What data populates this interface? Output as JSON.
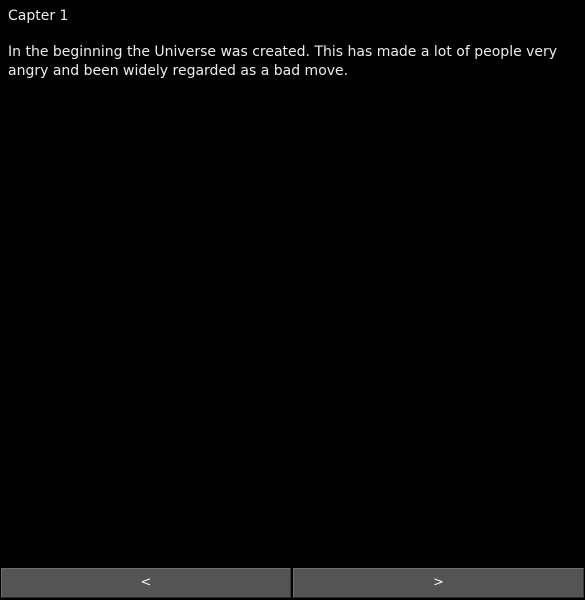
{
  "chapter": {
    "title": "Capter 1",
    "text": "In the beginning the Universe was created. This has made a lot of people very angry and been widely regarded as a bad move."
  },
  "navigation": {
    "prev_label": "<",
    "next_label": ">"
  },
  "colors": {
    "background": "#000000",
    "text": "#ececec",
    "button": "#545454"
  }
}
